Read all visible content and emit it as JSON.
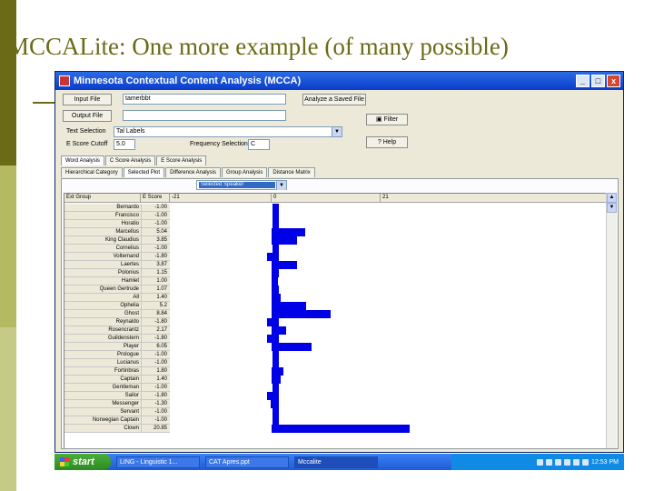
{
  "slide": {
    "title": "MCCALite:  One more example (of many possible)"
  },
  "window": {
    "title": "Minnesota Contextual Content Analysis (MCCA)",
    "minimize": "_",
    "maximize": "□",
    "close": "x"
  },
  "form": {
    "input_file_button": "Input File",
    "input_file_value": "tamerbbt",
    "analyze_saved_button": "Analyze a Saved File",
    "output_file_button": "Output File",
    "output_file_value": "",
    "filter_button": "Filter",
    "help_button": "Help",
    "text_selection_label": "Text Selection",
    "text_selection_value": "Tal Labels",
    "escore_cutoff_label": "E Score Cutoff",
    "escore_cutoff_value": "5.0",
    "freq_selection_label": "Frequency Selection",
    "freq_selection_value": "C"
  },
  "tabs_top": [
    "Word Analysis",
    "C Score Analysis",
    "E Score Analysis"
  ],
  "tabs_bottom": [
    "Hierarchical Category",
    "Selected Plot",
    "Difference Analysis",
    "Group Analysis",
    "Distance Matrix"
  ],
  "plot_select": {
    "value": "Selected Speaker"
  },
  "grid": {
    "headers": [
      "Ext Group",
      "E Score",
      "-21",
      "0",
      "21"
    ],
    "rows": [
      {
        "name": "Bernardo",
        "score": "-1.00"
      },
      {
        "name": "Francisco",
        "score": "-1.00"
      },
      {
        "name": "Horatio",
        "score": "-1.00"
      },
      {
        "name": "Marcellus",
        "score": "5.04"
      },
      {
        "name": "King Claudius",
        "score": "3.85"
      },
      {
        "name": "Cornelius",
        "score": "-1.00"
      },
      {
        "name": "Voltemand",
        "score": "-1.80"
      },
      {
        "name": "Laertes",
        "score": "3.87"
      },
      {
        "name": "Polonius",
        "score": "1.15"
      },
      {
        "name": "Hamlet",
        "score": "1.00"
      },
      {
        "name": "Queen Gertrude",
        "score": "1.07"
      },
      {
        "name": "All",
        "score": "1.40"
      },
      {
        "name": "Ophelia",
        "score": "5.2"
      },
      {
        "name": "Ghost",
        "score": "8.84"
      },
      {
        "name": "Reynaldo",
        "score": "-1.80"
      },
      {
        "name": "Rosencrantz",
        "score": "2.17"
      },
      {
        "name": "Guildenstern",
        "score": "-1.80"
      },
      {
        "name": "Player",
        "score": "6.05"
      },
      {
        "name": "Prologue",
        "score": "-1.00"
      },
      {
        "name": "Lucianus",
        "score": "-1.00"
      },
      {
        "name": "Fortinbras",
        "score": "1.80"
      },
      {
        "name": "Captain",
        "score": "1.40"
      },
      {
        "name": "Gentleman",
        "score": "-1.00"
      },
      {
        "name": "Sailor",
        "score": "-1.80"
      },
      {
        "name": "Messenger",
        "score": "-1.30"
      },
      {
        "name": "Servant",
        "score": "-1.00"
      },
      {
        "name": "Norwegian Captain",
        "score": "-1.00"
      },
      {
        "name": "Clown",
        "score": "20.85"
      }
    ]
  },
  "taskbar": {
    "start": "start",
    "tasks": [
      "LING - Linguistic 1...",
      "CAT Apres.ppt",
      "Mccalite"
    ],
    "clock": "12:53 PM"
  },
  "colors": {
    "bar": "#0000e6",
    "titlebar": "#0a3cc9",
    "slide_accent": "#6b6a16"
  }
}
